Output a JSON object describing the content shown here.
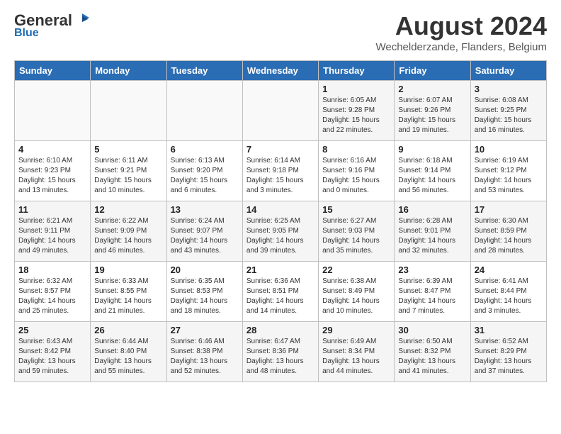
{
  "logo": {
    "general": "General",
    "blue": "Blue"
  },
  "header": {
    "month_title": "August 2024",
    "location": "Wechelderzande, Flanders, Belgium"
  },
  "days_of_week": [
    "Sunday",
    "Monday",
    "Tuesday",
    "Wednesday",
    "Thursday",
    "Friday",
    "Saturday"
  ],
  "weeks": [
    [
      {
        "day": "",
        "info": ""
      },
      {
        "day": "",
        "info": ""
      },
      {
        "day": "",
        "info": ""
      },
      {
        "day": "",
        "info": ""
      },
      {
        "day": "1",
        "info": "Sunrise: 6:05 AM\nSunset: 9:28 PM\nDaylight: 15 hours\nand 22 minutes."
      },
      {
        "day": "2",
        "info": "Sunrise: 6:07 AM\nSunset: 9:26 PM\nDaylight: 15 hours\nand 19 minutes."
      },
      {
        "day": "3",
        "info": "Sunrise: 6:08 AM\nSunset: 9:25 PM\nDaylight: 15 hours\nand 16 minutes."
      }
    ],
    [
      {
        "day": "4",
        "info": "Sunrise: 6:10 AM\nSunset: 9:23 PM\nDaylight: 15 hours\nand 13 minutes."
      },
      {
        "day": "5",
        "info": "Sunrise: 6:11 AM\nSunset: 9:21 PM\nDaylight: 15 hours\nand 10 minutes."
      },
      {
        "day": "6",
        "info": "Sunrise: 6:13 AM\nSunset: 9:20 PM\nDaylight: 15 hours\nand 6 minutes."
      },
      {
        "day": "7",
        "info": "Sunrise: 6:14 AM\nSunset: 9:18 PM\nDaylight: 15 hours\nand 3 minutes."
      },
      {
        "day": "8",
        "info": "Sunrise: 6:16 AM\nSunset: 9:16 PM\nDaylight: 15 hours\nand 0 minutes."
      },
      {
        "day": "9",
        "info": "Sunrise: 6:18 AM\nSunset: 9:14 PM\nDaylight: 14 hours\nand 56 minutes."
      },
      {
        "day": "10",
        "info": "Sunrise: 6:19 AM\nSunset: 9:12 PM\nDaylight: 14 hours\nand 53 minutes."
      }
    ],
    [
      {
        "day": "11",
        "info": "Sunrise: 6:21 AM\nSunset: 9:11 PM\nDaylight: 14 hours\nand 49 minutes."
      },
      {
        "day": "12",
        "info": "Sunrise: 6:22 AM\nSunset: 9:09 PM\nDaylight: 14 hours\nand 46 minutes."
      },
      {
        "day": "13",
        "info": "Sunrise: 6:24 AM\nSunset: 9:07 PM\nDaylight: 14 hours\nand 43 minutes."
      },
      {
        "day": "14",
        "info": "Sunrise: 6:25 AM\nSunset: 9:05 PM\nDaylight: 14 hours\nand 39 minutes."
      },
      {
        "day": "15",
        "info": "Sunrise: 6:27 AM\nSunset: 9:03 PM\nDaylight: 14 hours\nand 35 minutes."
      },
      {
        "day": "16",
        "info": "Sunrise: 6:28 AM\nSunset: 9:01 PM\nDaylight: 14 hours\nand 32 minutes."
      },
      {
        "day": "17",
        "info": "Sunrise: 6:30 AM\nSunset: 8:59 PM\nDaylight: 14 hours\nand 28 minutes."
      }
    ],
    [
      {
        "day": "18",
        "info": "Sunrise: 6:32 AM\nSunset: 8:57 PM\nDaylight: 14 hours\nand 25 minutes."
      },
      {
        "day": "19",
        "info": "Sunrise: 6:33 AM\nSunset: 8:55 PM\nDaylight: 14 hours\nand 21 minutes."
      },
      {
        "day": "20",
        "info": "Sunrise: 6:35 AM\nSunset: 8:53 PM\nDaylight: 14 hours\nand 18 minutes."
      },
      {
        "day": "21",
        "info": "Sunrise: 6:36 AM\nSunset: 8:51 PM\nDaylight: 14 hours\nand 14 minutes."
      },
      {
        "day": "22",
        "info": "Sunrise: 6:38 AM\nSunset: 8:49 PM\nDaylight: 14 hours\nand 10 minutes."
      },
      {
        "day": "23",
        "info": "Sunrise: 6:39 AM\nSunset: 8:47 PM\nDaylight: 14 hours\nand 7 minutes."
      },
      {
        "day": "24",
        "info": "Sunrise: 6:41 AM\nSunset: 8:44 PM\nDaylight: 14 hours\nand 3 minutes."
      }
    ],
    [
      {
        "day": "25",
        "info": "Sunrise: 6:43 AM\nSunset: 8:42 PM\nDaylight: 13 hours\nand 59 minutes."
      },
      {
        "day": "26",
        "info": "Sunrise: 6:44 AM\nSunset: 8:40 PM\nDaylight: 13 hours\nand 55 minutes."
      },
      {
        "day": "27",
        "info": "Sunrise: 6:46 AM\nSunset: 8:38 PM\nDaylight: 13 hours\nand 52 minutes."
      },
      {
        "day": "28",
        "info": "Sunrise: 6:47 AM\nSunset: 8:36 PM\nDaylight: 13 hours\nand 48 minutes."
      },
      {
        "day": "29",
        "info": "Sunrise: 6:49 AM\nSunset: 8:34 PM\nDaylight: 13 hours\nand 44 minutes."
      },
      {
        "day": "30",
        "info": "Sunrise: 6:50 AM\nSunset: 8:32 PM\nDaylight: 13 hours\nand 41 minutes."
      },
      {
        "day": "31",
        "info": "Sunrise: 6:52 AM\nSunset: 8:29 PM\nDaylight: 13 hours\nand 37 minutes."
      }
    ]
  ]
}
